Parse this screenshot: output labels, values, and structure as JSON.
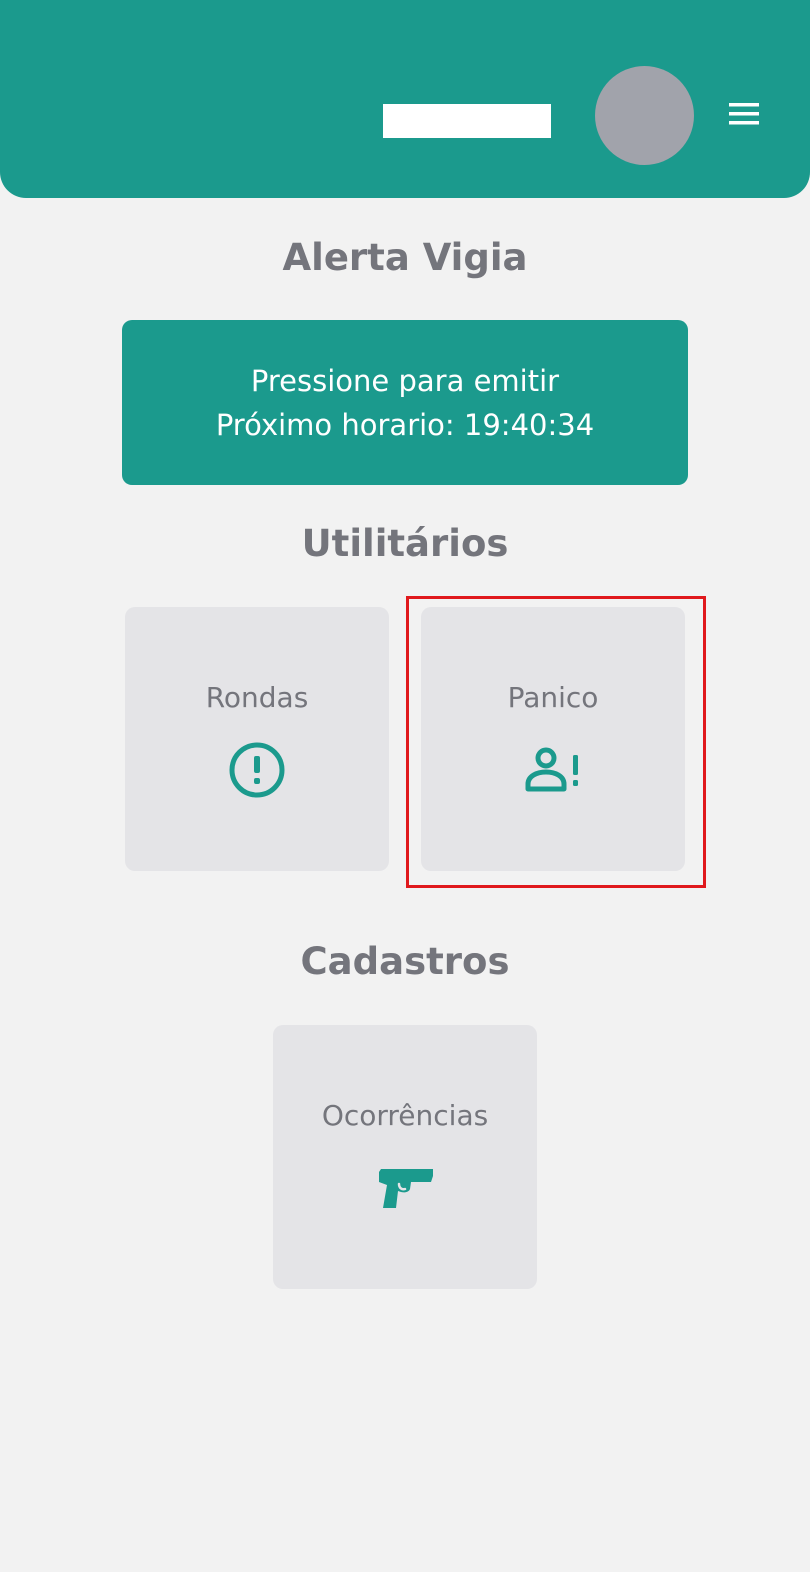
{
  "header": {
    "avatar_icon": "user-avatar",
    "menu_icon": "hamburger-menu-icon",
    "background_color": "#1b9a8d"
  },
  "alert": {
    "title": "Alerta Vigia",
    "button_line1": "Pressione para emitir",
    "button_line2": "Próximo horario: 19:40:34"
  },
  "utilities": {
    "title": "Utilitários",
    "items": [
      {
        "label": "Rondas",
        "icon": "exclamation-circle-icon"
      },
      {
        "label": "Panico",
        "icon": "person-alert-icon",
        "highlighted": true
      }
    ]
  },
  "registrations": {
    "title": "Cadastros",
    "items": [
      {
        "label": "Ocorrências",
        "icon": "pistol-icon"
      }
    ]
  },
  "colors": {
    "accent": "#1b9a8d",
    "background": "#f2f2f2",
    "card": "#e4e4e7",
    "text": "#74757c",
    "highlight": "#e0191d"
  }
}
